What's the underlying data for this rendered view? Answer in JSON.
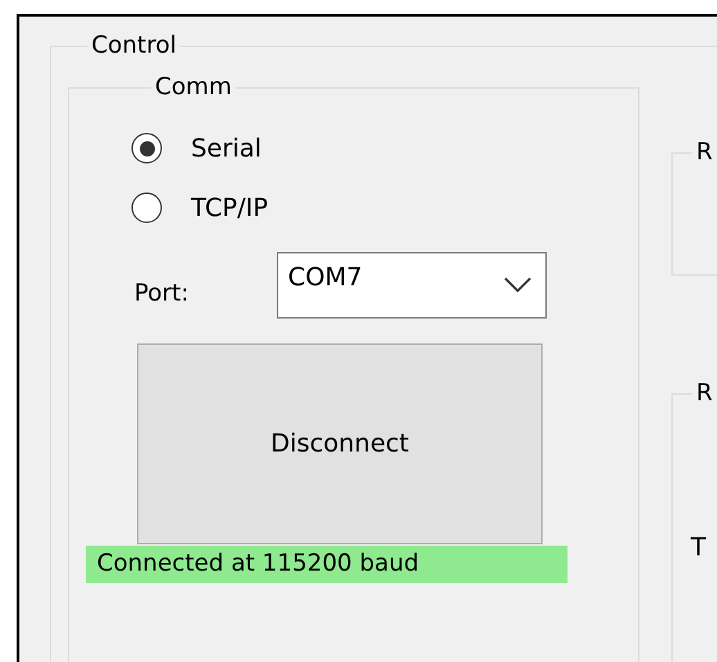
{
  "control": {
    "title": "Control",
    "comm": {
      "title": "Comm",
      "modes": [
        {
          "label": "Serial",
          "selected": true
        },
        {
          "label": "TCP/IP",
          "selected": false
        }
      ],
      "port": {
        "label": "Port:",
        "value": "COM7"
      },
      "button": "Disconnect",
      "status": {
        "text": "Connected at 115200 baud",
        "connected": true
      }
    },
    "side_groups": [
      {
        "title": "R"
      },
      {
        "title": "R",
        "items": [
          "T"
        ]
      }
    ]
  }
}
